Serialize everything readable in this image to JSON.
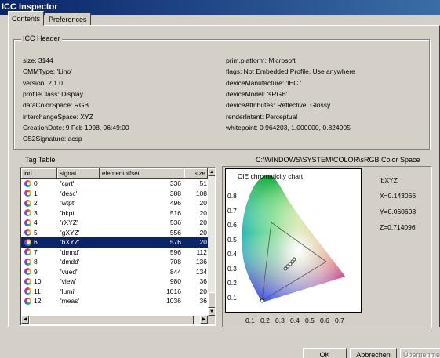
{
  "window": {
    "title": "ICC Inspector"
  },
  "tabs": [
    {
      "label": "Contents"
    },
    {
      "label": "Preferences"
    }
  ],
  "header_group": {
    "title": "ICC Header",
    "left": [
      "size: 3144",
      "CMMType: 'Lino'",
      "version: 2.1.0",
      "profileClass: Display",
      "dataColorSpace: RGB",
      "interchangeSpace: XYZ",
      "CreationDate: 9 Feb 1998, 06:49:00",
      "CS2Signature: acsp"
    ],
    "right": [
      "prim.platform: Microsoft",
      "flags: Not Embedded Profile, Use anywhere",
      "deviceManufacture: 'IEC '",
      "deviceModel: 'sRGB'",
      "deviceAttributes: Reflective, Glossy",
      "renderIntent: Perceptual",
      "whitepoint: 0.964203, 1.000000, 0.824905"
    ]
  },
  "tag_table": {
    "label": "Tag Table:",
    "columns": [
      "ind",
      "signat",
      "elementoffset",
      "size"
    ],
    "rows": [
      {
        "ind": "0",
        "sig": "'cprt'",
        "off": "336",
        "size": "51"
      },
      {
        "ind": "1",
        "sig": "'desc'",
        "off": "388",
        "size": "108"
      },
      {
        "ind": "2",
        "sig": "'wtpt'",
        "off": "496",
        "size": "20"
      },
      {
        "ind": "3",
        "sig": "'bkpt'",
        "off": "516",
        "size": "20"
      },
      {
        "ind": "4",
        "sig": "'rXYZ'",
        "off": "536",
        "size": "20"
      },
      {
        "ind": "5",
        "sig": "'gXYZ'",
        "off": "556",
        "size": "20"
      },
      {
        "ind": "6",
        "sig": "'bXYZ'",
        "off": "576",
        "size": "20"
      },
      {
        "ind": "7",
        "sig": "'dmnd'",
        "off": "596",
        "size": "112"
      },
      {
        "ind": "8",
        "sig": "'dmdd'",
        "off": "708",
        "size": "136"
      },
      {
        "ind": "9",
        "sig": "'vued'",
        "off": "844",
        "size": "134"
      },
      {
        "ind": "10",
        "sig": "'view'",
        "off": "980",
        "size": "36"
      },
      {
        "ind": "11",
        "sig": "'lumi'",
        "off": "1016",
        "size": "20"
      },
      {
        "ind": "12",
        "sig": "'meas'",
        "off": "1036",
        "size": "36"
      }
    ],
    "selected_index": 6
  },
  "profile_path": "C:\\WINDOWS\\SYSTEM\\COLOR\\sRGB Color Space",
  "chart": {
    "title": "CIE chromaticity chart",
    "tag": "'bXYZ'",
    "x": "X=0.143066",
    "y": "Y=0.060608",
    "z": "Z=0.714096",
    "y_ticks": [
      "0.8",
      "0.7",
      "0.6",
      "0.5",
      "0.4",
      "0.3",
      "0.2",
      "0.1"
    ],
    "x_ticks": [
      "0.1",
      "0.2",
      "0.3",
      "0.4",
      "0.5",
      "0.6",
      "0.7"
    ]
  },
  "buttons": {
    "ok": "OK",
    "cancel": "Abbrechen",
    "apply": "Übernehmen"
  }
}
